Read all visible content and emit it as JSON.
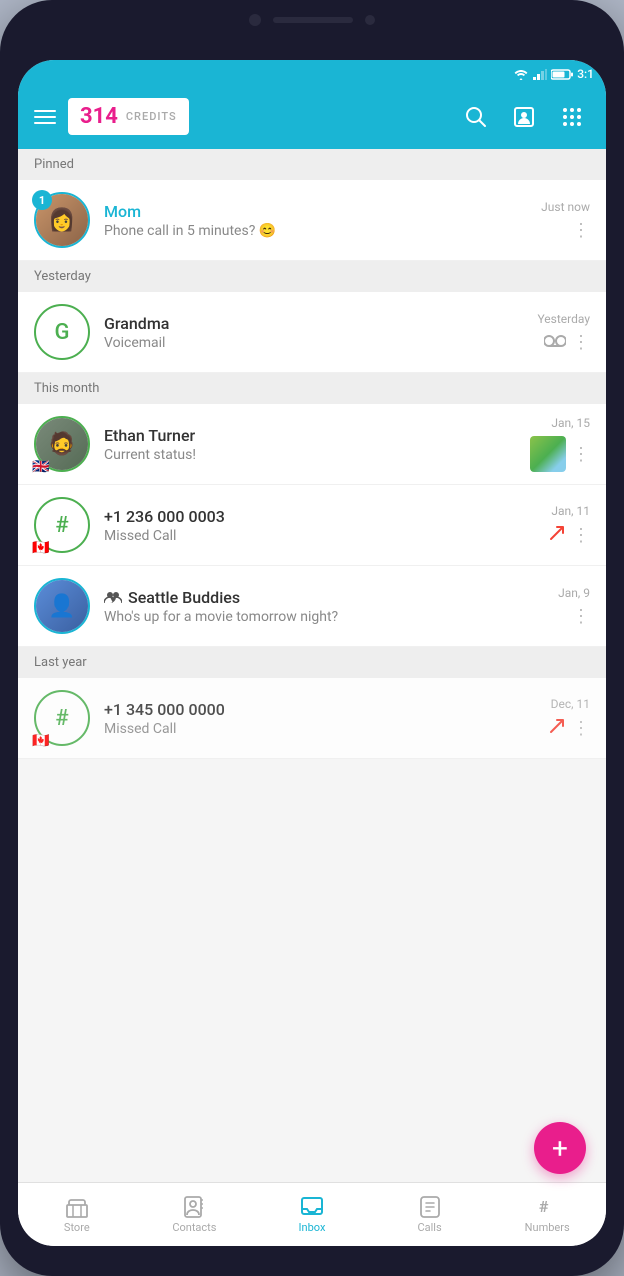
{
  "status_bar": {
    "time": "3:1",
    "battery": "70"
  },
  "header": {
    "credits_number": "314",
    "credits_label": "CREDITS",
    "hamburger_label": "Menu",
    "search_label": "Search",
    "contact_label": "Contact",
    "keypad_label": "Keypad"
  },
  "sections": {
    "pinned": "Pinned",
    "yesterday": "Yesterday",
    "this_month": "This month",
    "last_year": "Last year"
  },
  "conversations": [
    {
      "id": "mom",
      "name": "Mom",
      "preview": "Phone call in 5 minutes? 😊",
      "time": "Just now",
      "badge": "1",
      "avatar_type": "photo",
      "avatar_color": "#c9956a",
      "name_color": "blue",
      "has_border": "blue",
      "action": "more"
    },
    {
      "id": "grandma",
      "name": "Grandma",
      "preview": "Voicemail",
      "time": "Yesterday",
      "avatar_type": "initial",
      "initial": "G",
      "avatar_color": "#ffffff",
      "border_color": "#4caf50",
      "action": "voicemail"
    },
    {
      "id": "ethan",
      "name": "Ethan Turner",
      "preview": "Current status!",
      "time": "Jan, 15",
      "avatar_type": "photo",
      "avatar_color": "#7a8a7a",
      "action": "thumb_more",
      "flag": "🇬🇧"
    },
    {
      "id": "number1",
      "name": "+1 236 000 0003",
      "preview": "Missed Call",
      "time": "Jan, 11",
      "avatar_type": "initial",
      "initial": "#",
      "avatar_color": "#ffffff",
      "border_color": "#4caf50",
      "action": "missed_more",
      "flag": "🇨🇦"
    },
    {
      "id": "seattle",
      "name": "Seattle Buddies",
      "preview": "Who's up for a movie tomorrow night?",
      "time": "Jan, 9",
      "avatar_type": "group_photo",
      "avatar_color": "#5b8dd9",
      "action": "more",
      "is_group": true
    },
    {
      "id": "number2",
      "name": "+1 345 000 0000",
      "preview": "Missed Call",
      "time": "Dec, 11",
      "avatar_type": "initial",
      "initial": "#",
      "avatar_color": "#ffffff",
      "border_color": "#4caf50",
      "action": "missed_more",
      "flag": "🇨🇦",
      "partial": true
    }
  ],
  "bottom_nav": [
    {
      "id": "store",
      "label": "Store",
      "icon": "store"
    },
    {
      "id": "contacts",
      "label": "Contacts",
      "icon": "contacts"
    },
    {
      "id": "inbox",
      "label": "Inbox",
      "icon": "inbox",
      "active": true
    },
    {
      "id": "calls",
      "label": "Calls",
      "icon": "calls"
    },
    {
      "id": "numbers",
      "label": "Numbers",
      "icon": "numbers"
    }
  ],
  "fab": {
    "label": "+"
  }
}
